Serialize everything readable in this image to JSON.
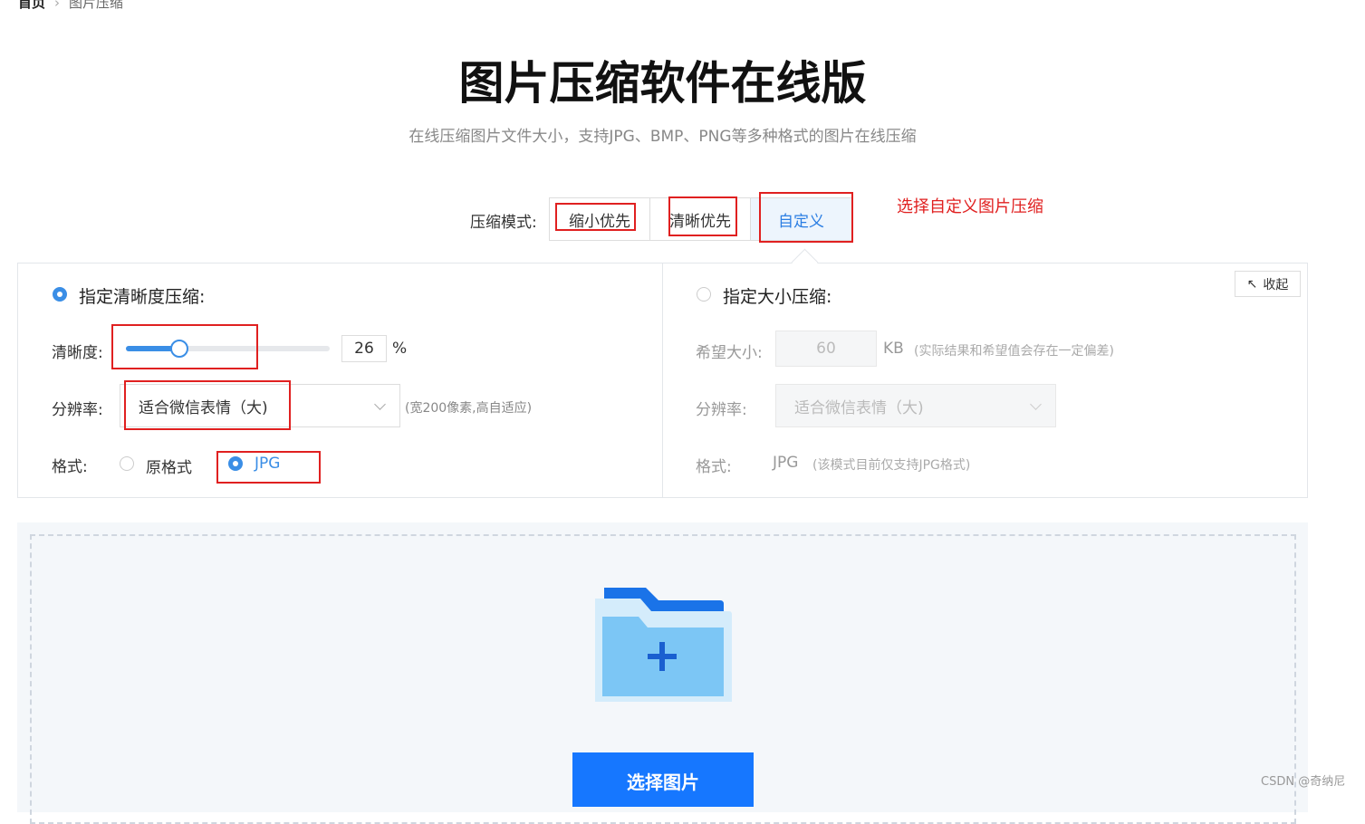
{
  "breadcrumb": {
    "home": "首页",
    "current": "图片压缩"
  },
  "page": {
    "title": "图片压缩软件在线版",
    "subtitle": "在线压缩图片文件大小，支持JPG、BMP、PNG等多种格式的图片在线压缩"
  },
  "mode": {
    "label": "压缩模式:",
    "options": [
      "缩小优先",
      "清晰优先",
      "自定义"
    ],
    "selected": "自定义"
  },
  "annotation": "选择自定义图片压缩",
  "collapse_label": "收起",
  "clarity_section": {
    "title": "指定清晰度压缩:",
    "selected": true,
    "clarity_label": "清晰度:",
    "clarity_value": "26",
    "clarity_unit": "%",
    "resolution_label": "分辨率:",
    "resolution_value": "适合微信表情（大)",
    "resolution_hint": "(宽200像素,高自适应)",
    "format_label": "格式:",
    "format_options": [
      "原格式",
      "JPG"
    ],
    "format_selected": "JPG"
  },
  "size_section": {
    "title": "指定大小压缩:",
    "selected": false,
    "size_label": "希望大小:",
    "size_value": "60",
    "size_unit": "KB",
    "size_hint": "(实际结果和希望值会存在一定偏差)",
    "resolution_label": "分辨率:",
    "resolution_value": "适合微信表情（大)",
    "format_label": "格式:",
    "format_value": "JPG",
    "format_hint": "(该模式目前仅支持JPG格式)"
  },
  "upload": {
    "button_label": "选择图片"
  },
  "watermark": "CSDN @奇纳尼",
  "colors": {
    "accent": "#1677ff",
    "annotation": "#e02020"
  }
}
